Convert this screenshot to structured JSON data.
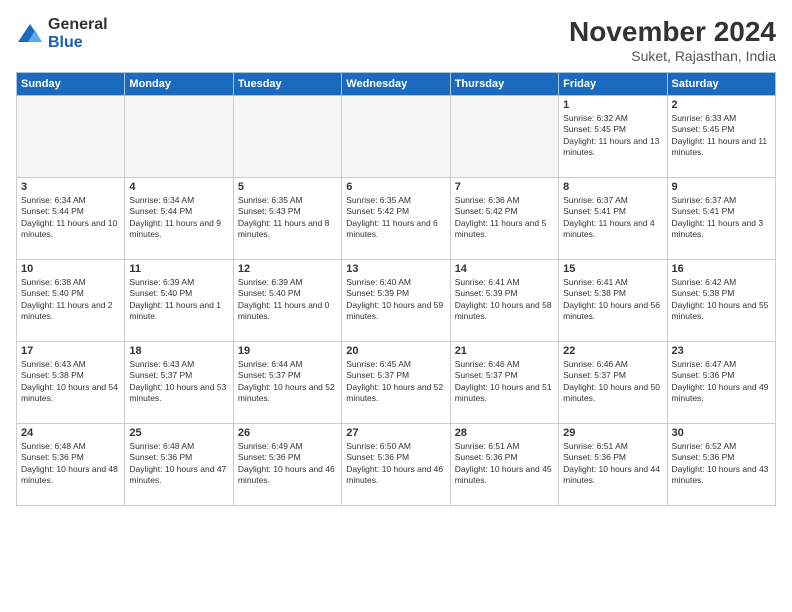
{
  "logo": {
    "general": "General",
    "blue": "Blue"
  },
  "header": {
    "month": "November 2024",
    "location": "Suket, Rajasthan, India"
  },
  "days_of_week": [
    "Sunday",
    "Monday",
    "Tuesday",
    "Wednesday",
    "Thursday",
    "Friday",
    "Saturday"
  ],
  "weeks": [
    [
      {
        "day": "",
        "empty": true
      },
      {
        "day": "",
        "empty": true
      },
      {
        "day": "",
        "empty": true
      },
      {
        "day": "",
        "empty": true
      },
      {
        "day": "",
        "empty": true
      },
      {
        "day": "1",
        "sunrise": "6:32 AM",
        "sunset": "5:45 PM",
        "daylight": "11 hours and 13 minutes."
      },
      {
        "day": "2",
        "sunrise": "6:33 AM",
        "sunset": "5:45 PM",
        "daylight": "11 hours and 11 minutes."
      }
    ],
    [
      {
        "day": "3",
        "sunrise": "6:34 AM",
        "sunset": "5:44 PM",
        "daylight": "11 hours and 10 minutes."
      },
      {
        "day": "4",
        "sunrise": "6:34 AM",
        "sunset": "5:44 PM",
        "daylight": "11 hours and 9 minutes."
      },
      {
        "day": "5",
        "sunrise": "6:35 AM",
        "sunset": "5:43 PM",
        "daylight": "11 hours and 8 minutes."
      },
      {
        "day": "6",
        "sunrise": "6:35 AM",
        "sunset": "5:42 PM",
        "daylight": "11 hours and 6 minutes."
      },
      {
        "day": "7",
        "sunrise": "6:36 AM",
        "sunset": "5:42 PM",
        "daylight": "11 hours and 5 minutes."
      },
      {
        "day": "8",
        "sunrise": "6:37 AM",
        "sunset": "5:41 PM",
        "daylight": "11 hours and 4 minutes."
      },
      {
        "day": "9",
        "sunrise": "6:37 AM",
        "sunset": "5:41 PM",
        "daylight": "11 hours and 3 minutes."
      }
    ],
    [
      {
        "day": "10",
        "sunrise": "6:38 AM",
        "sunset": "5:40 PM",
        "daylight": "11 hours and 2 minutes."
      },
      {
        "day": "11",
        "sunrise": "6:39 AM",
        "sunset": "5:40 PM",
        "daylight": "11 hours and 1 minute."
      },
      {
        "day": "12",
        "sunrise": "6:39 AM",
        "sunset": "5:40 PM",
        "daylight": "11 hours and 0 minutes."
      },
      {
        "day": "13",
        "sunrise": "6:40 AM",
        "sunset": "5:39 PM",
        "daylight": "10 hours and 59 minutes."
      },
      {
        "day": "14",
        "sunrise": "6:41 AM",
        "sunset": "5:39 PM",
        "daylight": "10 hours and 58 minutes."
      },
      {
        "day": "15",
        "sunrise": "6:41 AM",
        "sunset": "5:38 PM",
        "daylight": "10 hours and 56 minutes."
      },
      {
        "day": "16",
        "sunrise": "6:42 AM",
        "sunset": "5:38 PM",
        "daylight": "10 hours and 55 minutes."
      }
    ],
    [
      {
        "day": "17",
        "sunrise": "6:43 AM",
        "sunset": "5:38 PM",
        "daylight": "10 hours and 54 minutes."
      },
      {
        "day": "18",
        "sunrise": "6:43 AM",
        "sunset": "5:37 PM",
        "daylight": "10 hours and 53 minutes."
      },
      {
        "day": "19",
        "sunrise": "6:44 AM",
        "sunset": "5:37 PM",
        "daylight": "10 hours and 52 minutes."
      },
      {
        "day": "20",
        "sunrise": "6:45 AM",
        "sunset": "5:37 PM",
        "daylight": "10 hours and 52 minutes."
      },
      {
        "day": "21",
        "sunrise": "6:46 AM",
        "sunset": "5:37 PM",
        "daylight": "10 hours and 51 minutes."
      },
      {
        "day": "22",
        "sunrise": "6:46 AM",
        "sunset": "5:37 PM",
        "daylight": "10 hours and 50 minutes."
      },
      {
        "day": "23",
        "sunrise": "6:47 AM",
        "sunset": "5:36 PM",
        "daylight": "10 hours and 49 minutes."
      }
    ],
    [
      {
        "day": "24",
        "sunrise": "6:48 AM",
        "sunset": "5:36 PM",
        "daylight": "10 hours and 48 minutes."
      },
      {
        "day": "25",
        "sunrise": "6:48 AM",
        "sunset": "5:36 PM",
        "daylight": "10 hours and 47 minutes."
      },
      {
        "day": "26",
        "sunrise": "6:49 AM",
        "sunset": "5:36 PM",
        "daylight": "10 hours and 46 minutes."
      },
      {
        "day": "27",
        "sunrise": "6:50 AM",
        "sunset": "5:36 PM",
        "daylight": "10 hours and 46 minutes."
      },
      {
        "day": "28",
        "sunrise": "6:51 AM",
        "sunset": "5:36 PM",
        "daylight": "10 hours and 45 minutes."
      },
      {
        "day": "29",
        "sunrise": "6:51 AM",
        "sunset": "5:36 PM",
        "daylight": "10 hours and 44 minutes."
      },
      {
        "day": "30",
        "sunrise": "6:52 AM",
        "sunset": "5:36 PM",
        "daylight": "10 hours and 43 minutes."
      }
    ]
  ],
  "labels": {
    "sunrise": "Sunrise:",
    "sunset": "Sunset:",
    "daylight": "Daylight:"
  }
}
